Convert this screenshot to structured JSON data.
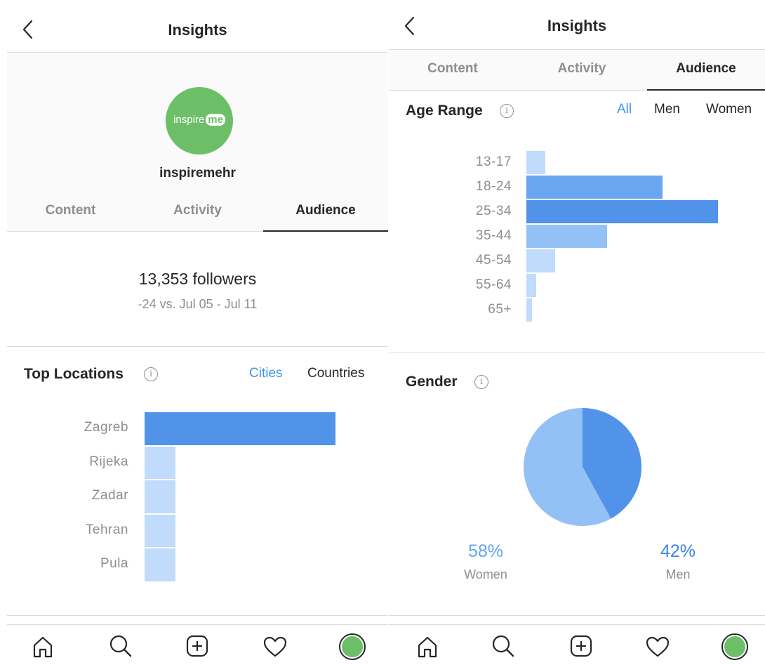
{
  "colors": {
    "primary_bar": "#5093e9",
    "secondary_bar": "#c0dbfb",
    "mid_bar": "#94c1f5",
    "link": "#3897f0",
    "muted": "#8e8e8e",
    "text": "#262626",
    "avatar_green": "#6dbf67"
  },
  "left": {
    "header": {
      "title": "Insights"
    },
    "profile": {
      "logo_text_a": "inspire",
      "logo_text_b": "me",
      "username": "inspiremehr"
    },
    "tabs": [
      {
        "label": "Content"
      },
      {
        "label": "Activity"
      },
      {
        "label": "Audience"
      }
    ],
    "followers": {
      "count": "13,353 followers",
      "change": "-24 vs. Jul 05 - Jul 11"
    },
    "top_locations": {
      "title": "Top Locations",
      "info": "i",
      "filters": [
        {
          "label": "Cities"
        },
        {
          "label": "Countries"
        }
      ],
      "selected_filter": "Cities"
    }
  },
  "right": {
    "header": {
      "title": "Insights"
    },
    "tabs": [
      {
        "label": "Content"
      },
      {
        "label": "Activity"
      },
      {
        "label": "Audience"
      }
    ],
    "age_range": {
      "title": "Age Range",
      "info": "i",
      "filters": [
        {
          "label": "All"
        },
        {
          "label": "Men"
        },
        {
          "label": "Women"
        }
      ],
      "selected_filter": "All"
    },
    "gender": {
      "title": "Gender",
      "info": "i",
      "women": {
        "pct": "58%",
        "label": "Women"
      },
      "men": {
        "pct": "42%",
        "label": "Men"
      }
    }
  },
  "bottom_nav": {
    "icons": [
      "home-icon",
      "search-icon",
      "new-post-icon",
      "activity-heart-icon",
      "profile-avatar-icon"
    ]
  },
  "chart_data": [
    {
      "type": "bar",
      "orientation": "horizontal",
      "title": "Top Locations",
      "categories": [
        "Zagreb",
        "Rijeka",
        "Zadar",
        "Tehran",
        "Pula"
      ],
      "values": [
        100,
        16,
        16,
        16,
        16
      ],
      "unit": "relative share (no axis printed)"
    },
    {
      "type": "bar",
      "orientation": "horizontal",
      "title": "Age Range",
      "categories": [
        "13-17",
        "18-24",
        "25-34",
        "35-44",
        "45-54",
        "55-64",
        "65+"
      ],
      "values": [
        10,
        71,
        100,
        42,
        15,
        5,
        3
      ],
      "unit": "relative share (no axis printed)"
    },
    {
      "type": "pie",
      "title": "Gender",
      "categories": [
        "Women",
        "Men"
      ],
      "values": [
        58,
        42
      ]
    }
  ]
}
